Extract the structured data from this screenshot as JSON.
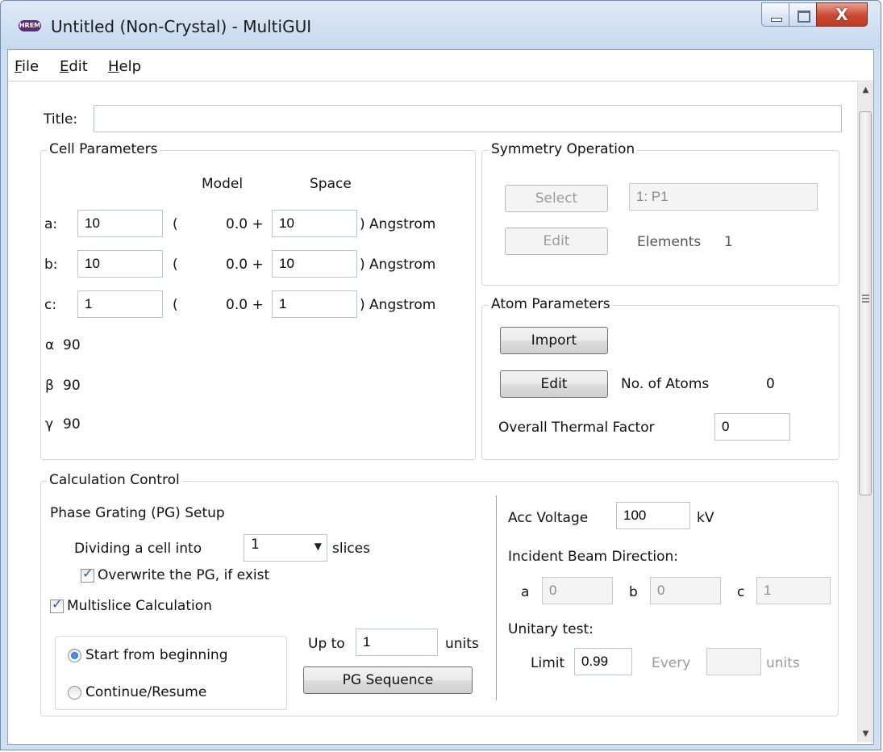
{
  "window": {
    "title": "Untitled (Non-Crystal) - MultiGUI",
    "icon_text": "HREM",
    "close_glyph": "X"
  },
  "menu": [
    {
      "label": "File",
      "mnemonic": "F",
      "rest": "ile"
    },
    {
      "label": "Edit",
      "mnemonic": "E",
      "rest": "dit"
    },
    {
      "label": "Help",
      "mnemonic": "H",
      "rest": "elp"
    }
  ],
  "title_field": {
    "label": "Title:",
    "value": ""
  },
  "cell": {
    "group_title": "Cell Parameters",
    "col_model": "Model",
    "col_space": "Space",
    "rows": [
      {
        "label": "a:",
        "value": "10",
        "open": "(",
        "model": "0.0 +",
        "space": "10",
        "unit": ") Angstrom"
      },
      {
        "label": "b:",
        "value": "10",
        "open": "(",
        "model": "0.0 +",
        "space": "10",
        "unit": ") Angstrom"
      },
      {
        "label": "c:",
        "value": "1",
        "open": "(",
        "model": "0.0 +",
        "space": "1",
        "unit": ") Angstrom"
      }
    ],
    "angles": [
      {
        "label": "α",
        "value": "90"
      },
      {
        "label": "β",
        "value": "90"
      },
      {
        "label": "γ",
        "value": "90"
      }
    ]
  },
  "symmetry": {
    "group_title": "Symmetry Operation",
    "select_label": "Select",
    "spacegroup": "1: P1",
    "edit_label": "Edit",
    "elements_label": "Elements",
    "elements_value": "1"
  },
  "atoms": {
    "group_title": "Atom Parameters",
    "import_label": "Import",
    "edit_label": "Edit",
    "count_label": "No. of Atoms",
    "count_value": "0",
    "thermal_label": "Overall Thermal Factor",
    "thermal_value": "0"
  },
  "calc": {
    "group_title": "Calculation Control",
    "pg_setup": "Phase Grating (PG) Setup",
    "dividing_label": "Dividing a cell into",
    "slices_value": "1",
    "slices_label": "slices",
    "overwrite_label": "Overwrite the PG, if exist",
    "overwrite_checked": true,
    "multislice_label": "Multislice Calculation",
    "multislice_checked": true,
    "start_label": "Start from beginning",
    "continue_label": "Continue/Resume",
    "selected_mode": "start",
    "upto_label": "Up to",
    "upto_value": "1",
    "units_label": "units",
    "pg_sequence_label": "PG Sequence",
    "acc_label": "Acc Voltage",
    "acc_value": "100",
    "acc_unit": "kV",
    "beam_label": "Incident Beam Direction:",
    "beam": [
      {
        "label": "a",
        "value": "0"
      },
      {
        "label": "b",
        "value": "0"
      },
      {
        "label": "c",
        "value": "1"
      }
    ],
    "unitary_label": "Unitary test:",
    "limit_label": "Limit",
    "limit_value": "0.99",
    "every_label": "Every",
    "every_value": "",
    "every_units": "units"
  },
  "colors": {
    "window_frame": "#cfe0f3",
    "close_button": "#c84a32",
    "radio_selected": "#1f5fb8"
  }
}
